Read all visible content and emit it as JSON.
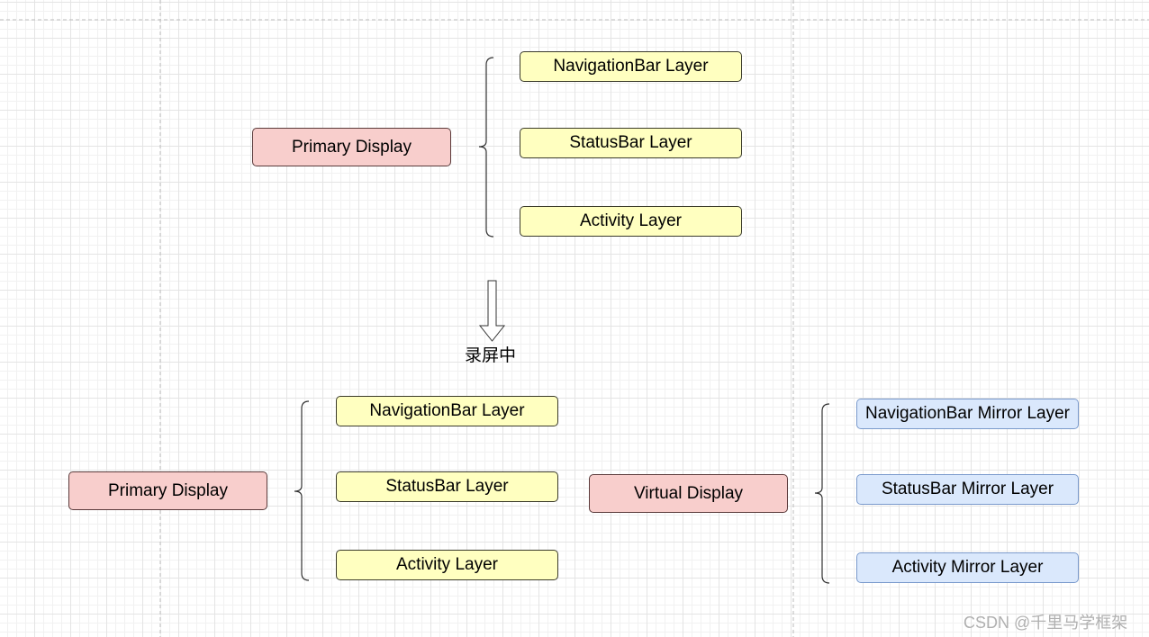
{
  "top": {
    "display": "Primary Display",
    "layers": [
      "NavigationBar Layer",
      "StatusBar Layer",
      "Activity Layer"
    ]
  },
  "arrow_label": "录屏中",
  "bottom": {
    "primary": {
      "display": "Primary Display",
      "layers": [
        "NavigationBar Layer",
        "StatusBar Layer",
        "Activity Layer"
      ]
    },
    "virtual": {
      "display": "Virtual Display",
      "layers": [
        "NavigationBar Mirror Layer",
        "StatusBar Mirror Layer",
        "Activity Mirror Layer"
      ]
    }
  },
  "watermark": "CSDN @千里马学框架",
  "colors": {
    "display": "#f8cecc",
    "layer": "#ffffc0",
    "mirror_layer": "#dae8fc"
  }
}
